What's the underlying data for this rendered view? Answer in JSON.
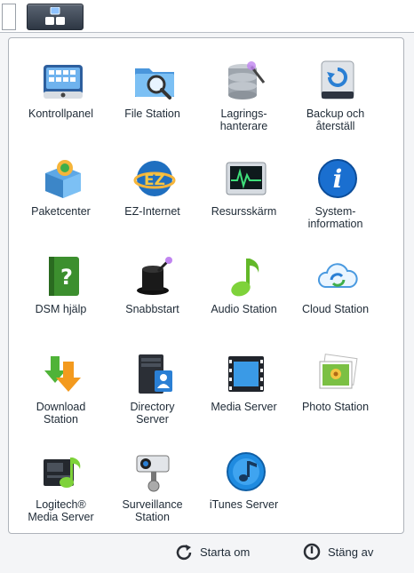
{
  "apps": [
    {
      "label": "Kontrollpanel",
      "icon": "control-panel-icon"
    },
    {
      "label": "File Station",
      "icon": "file-station-icon"
    },
    {
      "label": "Lagrings-\nhanterare",
      "icon": "storage-manager-icon"
    },
    {
      "label": "Backup och\nåterställ",
      "icon": "backup-restore-icon"
    },
    {
      "label": "Paketcenter",
      "icon": "package-center-icon"
    },
    {
      "label": "EZ-Internet",
      "icon": "ez-internet-icon"
    },
    {
      "label": "Resursskärm",
      "icon": "resource-monitor-icon"
    },
    {
      "label": "System-\ninformation",
      "icon": "system-information-icon"
    },
    {
      "label": "DSM hjälp",
      "icon": "dsm-help-icon"
    },
    {
      "label": "Snabbstart",
      "icon": "quick-start-icon"
    },
    {
      "label": "Audio Station",
      "icon": "audio-station-icon"
    },
    {
      "label": "Cloud Station",
      "icon": "cloud-station-icon"
    },
    {
      "label": "Download\nStation",
      "icon": "download-station-icon"
    },
    {
      "label": "Directory\nServer",
      "icon": "directory-server-icon"
    },
    {
      "label": "Media Server",
      "icon": "media-server-icon"
    },
    {
      "label": "Photo Station",
      "icon": "photo-station-icon"
    },
    {
      "label": "Logitech®\nMedia Server",
      "icon": "logitech-media-server-icon"
    },
    {
      "label": "Surveillance\nStation",
      "icon": "surveillance-station-icon"
    },
    {
      "label": "iTunes Server",
      "icon": "itunes-server-icon"
    }
  ],
  "footer": {
    "restart_label": "Starta om",
    "shutdown_label": "Stäng av"
  },
  "colors": {
    "text": "#1e2a36",
    "panel_border": "#aeb3ba",
    "taskbar_button": "#2e3744",
    "accent_blue": "#2a7fd4"
  }
}
